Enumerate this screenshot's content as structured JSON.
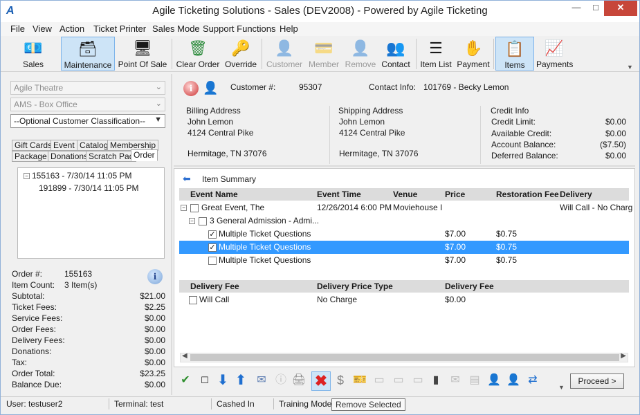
{
  "window": {
    "title": "Agile Ticketing Solutions - Sales (DEV2008) - Powered by Agile Ticketing",
    "logo_icon": "agile-logo-icon"
  },
  "menu": [
    "File",
    "View",
    "Action",
    "Ticket Printer",
    "Sales Mode",
    "Support Functions",
    "Help"
  ],
  "toolbar": {
    "buttons": [
      {
        "label": "Sales",
        "icon": "cash-register-icon",
        "state": "normal"
      },
      {
        "label": "Maintenance",
        "icon": "server-icon",
        "state": "active"
      },
      {
        "label": "Point Of Sale",
        "icon": "monitor-icon",
        "state": "normal"
      },
      {
        "label": "Clear Order",
        "icon": "trash-clear-icon",
        "state": "normal"
      },
      {
        "label": "Override",
        "icon": "key-icon",
        "state": "normal"
      },
      {
        "label": "Customer",
        "icon": "customer-search-icon",
        "state": "disabled"
      },
      {
        "label": "Member",
        "icon": "member-card-icon",
        "state": "disabled"
      },
      {
        "label": "Remove",
        "icon": "remove-person-icon",
        "state": "disabled"
      },
      {
        "label": "Contact",
        "icon": "contacts-icon",
        "state": "normal"
      },
      {
        "label": "Item List",
        "icon": "list-icon",
        "state": "normal"
      },
      {
        "label": "Payment",
        "icon": "payment-hand-icon",
        "state": "normal"
      },
      {
        "label": "Items",
        "icon": "items-icon",
        "state": "active"
      },
      {
        "label": "Payments",
        "icon": "payments-icon",
        "state": "normal"
      }
    ]
  },
  "left": {
    "combo_venue": "Agile Theatre",
    "combo_office": "AMS - Box Office",
    "combo_classification": "--Optional Customer Classification--",
    "tabs_row1": [
      "Gift Cards",
      "Event",
      "Catalog",
      "Membership"
    ],
    "tabs_row2": [
      "Package",
      "Donations",
      "Scratch Pad",
      "Order"
    ],
    "selected_tab": "Order",
    "tree": [
      {
        "label": "155163 - 7/30/14 11:05 PM"
      },
      {
        "label": "191899 - 7/30/14 11:05 PM"
      }
    ],
    "summary": {
      "order_num_label": "Order #:",
      "order_num": "155163",
      "item_count_label": "Item Count:",
      "item_count": "3 Item(s)",
      "rows": [
        {
          "label": "Subtotal:",
          "value": "$21.00"
        },
        {
          "label": "Ticket Fees:",
          "value": "$2.25"
        },
        {
          "label": "Service Fees:",
          "value": "$0.00"
        },
        {
          "label": "Order Fees:",
          "value": "$0.00"
        },
        {
          "label": "Delivery Fees:",
          "value": "$0.00"
        },
        {
          "label": "Donations:",
          "value": "$0.00"
        },
        {
          "label": "Tax:",
          "value": "$0.00"
        },
        {
          "label": "Order Total:",
          "value": "$23.25"
        },
        {
          "label": "Balance Due:",
          "value": "$0.00"
        }
      ]
    }
  },
  "customer": {
    "customer_label": "Customer #:",
    "customer_num": "95307",
    "contact_label": "Contact Info:",
    "contact_value": "101769 - Becky Lemon",
    "billing": {
      "heading": "Billing Address",
      "line1": "John Lemon",
      "line2": "4124 Central Pike",
      "line3": "Hermitage, TN 37076"
    },
    "shipping": {
      "heading": "Shipping Address",
      "line1": "John Lemon",
      "line2": "4124 Central Pike",
      "line3": "Hermitage, TN 37076"
    },
    "credit": {
      "heading": "Credit Info",
      "rows": [
        {
          "label": "Credit Limit:",
          "value": "$0.00"
        },
        {
          "label": "Available Credit:",
          "value": "$0.00"
        },
        {
          "label": "Account Balance:",
          "value": "($7.50)"
        },
        {
          "label": "Deferred Balance:",
          "value": "$0.00"
        }
      ]
    }
  },
  "items": {
    "header": "Item Summary",
    "columns": [
      "Event Name",
      "Event Time",
      "Venue",
      "Price",
      "Restoration Fee",
      "Delivery"
    ],
    "event_row": {
      "name": "Great Event, The",
      "time": "12/26/2014 6:00 PM",
      "venue": "Moviehouse I",
      "delivery": "Will Call - No Charg"
    },
    "admission_row": {
      "name": "3 General Admission - Admi..."
    },
    "ticket_rows": [
      {
        "name": "Multiple Ticket Questions",
        "checked": true,
        "price": "$7.00",
        "fee": "$0.75",
        "selected": false
      },
      {
        "name": "Multiple Ticket Questions",
        "checked": true,
        "price": "$7.00",
        "fee": "$0.75",
        "selected": true
      },
      {
        "name": "Multiple Ticket Questions",
        "checked": false,
        "price": "$7.00",
        "fee": "$0.75",
        "selected": false
      }
    ],
    "delivery_columns": [
      "Delivery Fee",
      "Delivery Price Type",
      "Delivery Fee"
    ],
    "delivery_row": {
      "name": "Will Call",
      "type": "No Charge",
      "fee": "$0.00"
    }
  },
  "actions": {
    "proceed": "Proceed >",
    "tooltip": "Remove Selected"
  },
  "status": {
    "user": "User:  testuser2",
    "terminal": "Terminal: test",
    "cashed": "Cashed In",
    "mode": "Training Mode"
  },
  "colors": {
    "selection": "#3399ff",
    "active_toolbar": "#cde4f7",
    "close_button": "#c7463a"
  }
}
